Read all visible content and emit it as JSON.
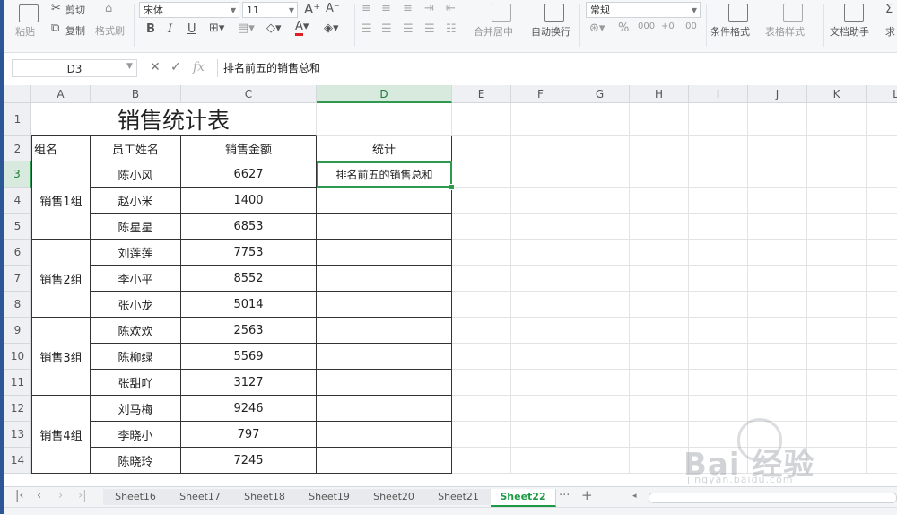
{
  "ribbon": {
    "paste": "粘贴",
    "cut": "剪切",
    "copy": "复制",
    "format_painter": "格式刷",
    "font_name": "宋体",
    "font_size": "11",
    "bold": "B",
    "italic": "I",
    "underline": "U",
    "merge_center": "合并居中",
    "wrap_text": "自动换行",
    "number_format": "常规",
    "percent": "%",
    "cond_format": "条件格式",
    "table_style": "表格样式",
    "doc_helper": "文档助手",
    "sum_partial": "求"
  },
  "formula_bar": {
    "name_box": "D3",
    "cancel_glyph": "✕",
    "confirm_glyph": "✓",
    "fx_label": "fx",
    "formula": "排名前五的销售总和"
  },
  "columns": [
    "A",
    "B",
    "C",
    "D",
    "E",
    "F",
    "G",
    "H",
    "I",
    "J",
    "K",
    "L"
  ],
  "rows": [
    "1",
    "2",
    "3",
    "4",
    "5",
    "6",
    "7",
    "8",
    "9",
    "10",
    "11",
    "12",
    "13",
    "14"
  ],
  "table": {
    "title": "销售统计表",
    "headers": [
      "组名",
      "员工姓名",
      "销售金额",
      "统计"
    ],
    "groups": [
      "销售1组",
      "销售2组",
      "销售3组",
      "销售4组"
    ],
    "names": [
      "陈小风",
      "赵小米",
      "陈星星",
      "刘莲莲",
      "李小平",
      "张小龙",
      "陈欢欢",
      "陈柳绿",
      "张甜吖",
      "刘马梅",
      "李晓小",
      "陈晓玲"
    ],
    "amounts": [
      "6627",
      "1400",
      "6853",
      "7753",
      "8552",
      "5014",
      "2563",
      "5569",
      "3127",
      "9246",
      "797",
      "7245"
    ],
    "stat_cell": "排名前五的销售总和"
  },
  "sheets": [
    "Sheet16",
    "Sheet17",
    "Sheet18",
    "Sheet19",
    "Sheet20",
    "Sheet21",
    "Sheet22"
  ],
  "active_sheet": "Sheet22",
  "more_sheets": "···",
  "add_sheet": "+",
  "watermark": {
    "main": "Bai 经验",
    "sub": "jingyan.baidu.com"
  },
  "colors": {
    "accent": "#2f9a4f",
    "sheet_active": "#1e9a45",
    "font_color_bar": "#e02020"
  }
}
